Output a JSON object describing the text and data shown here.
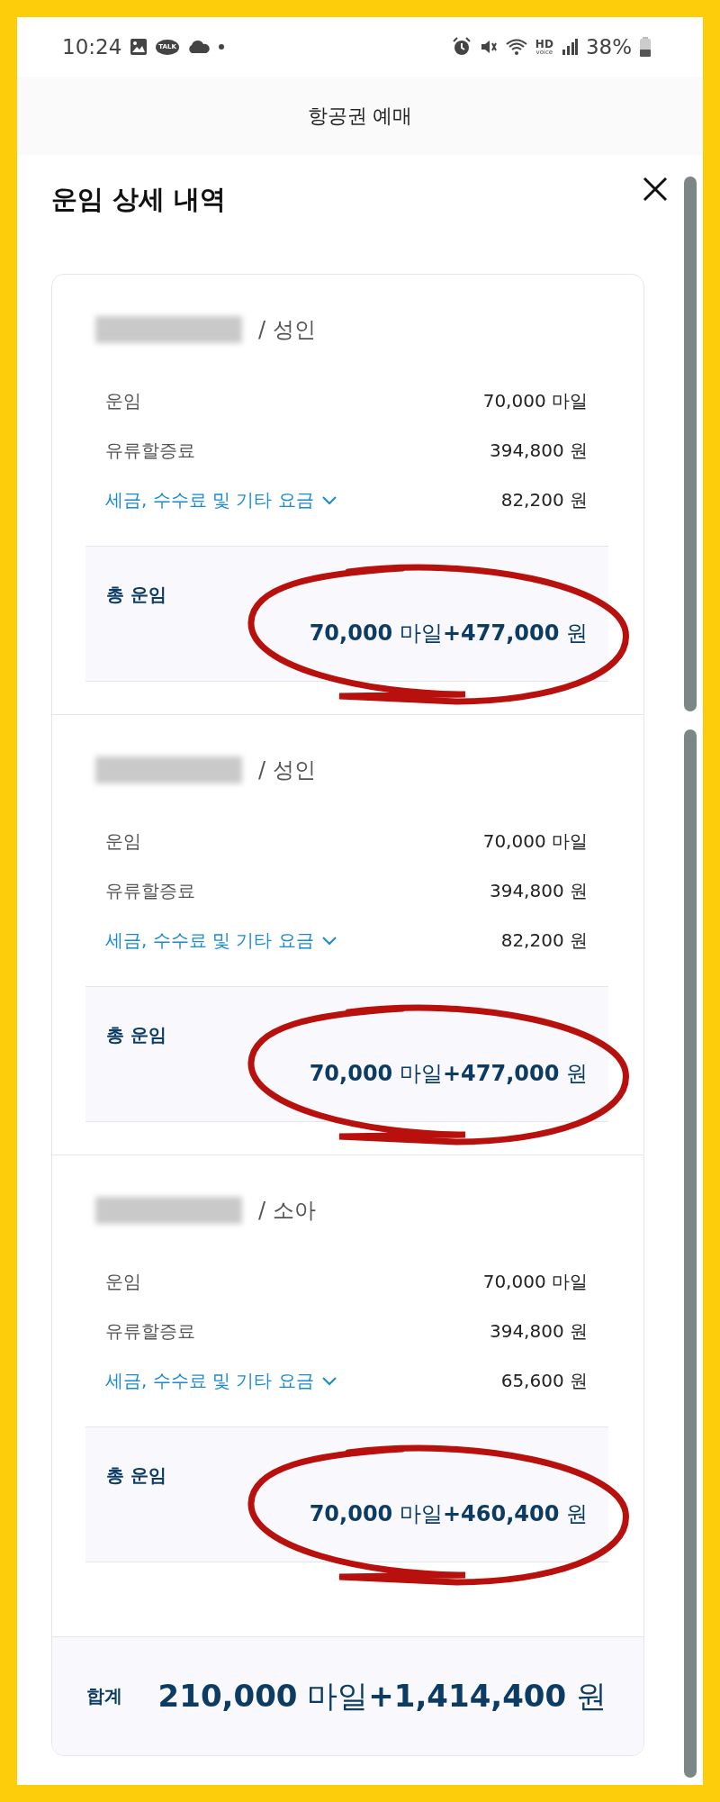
{
  "status_bar": {
    "time": "10:24",
    "talk": "TALK",
    "hd": "HD",
    "voice": "voice",
    "battery": "38%"
  },
  "header": {
    "title": "항공권 예매"
  },
  "sheet": {
    "title": "운임 상세 내역"
  },
  "passengers": [
    {
      "type": "/ 성인",
      "rows": [
        {
          "kind": "plain",
          "label": "운임",
          "value": "70,000 마일"
        },
        {
          "kind": "plain",
          "label": "유류할증료",
          "value": "394,800 원"
        },
        {
          "kind": "expandable",
          "label": "세금, 수수료 및 기타 요금",
          "value": "82,200 원",
          "expanded": false
        }
      ],
      "total": {
        "label": "총 운임",
        "amount": "**70,000** 마일**+477,000** 원",
        "circled": true
      }
    },
    {
      "type": "/ 성인",
      "rows": [
        {
          "kind": "plain",
          "label": "운임",
          "value": "70,000 마일"
        },
        {
          "kind": "plain",
          "label": "유류할증료",
          "value": "394,800 원"
        },
        {
          "kind": "expandable",
          "label": "세금, 수수료 및 기타 요금",
          "value": "82,200 원",
          "expanded": false
        }
      ],
      "total": {
        "label": "총 운임",
        "amount": "**70,000** 마일**+477,000** 원",
        "circled": true
      }
    },
    {
      "type": "/ 소아",
      "rows": [
        {
          "kind": "plain",
          "label": "운임",
          "value": "70,000 마일"
        },
        {
          "kind": "plain",
          "label": "유류할증료",
          "value": "394,800 원"
        },
        {
          "kind": "expandable",
          "label": "세금, 수수료 및 기타 요금",
          "value": "65,600 원",
          "expanded": false
        }
      ],
      "total": {
        "label": "총 운임",
        "amount": "**70,000** 마일**+460,400** 원",
        "circled": true
      }
    }
  ],
  "grand_total": {
    "label": "합계",
    "amount": "**210,000** 마일**+1,414,400** 원"
  }
}
